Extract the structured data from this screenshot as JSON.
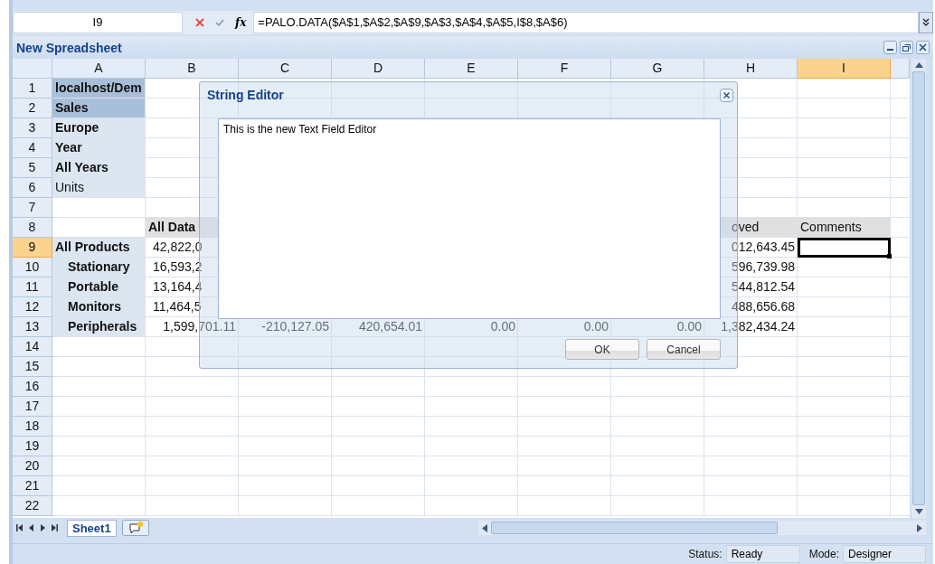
{
  "formula_bar": {
    "cell_name": "I9",
    "function_label": "fx",
    "formula": "=PALO.DATA($A$1,$A$2,$A$9,$A$3,$A$4,$A$5,I$8,$A$6)"
  },
  "window": {
    "title": "New Spreadsheet"
  },
  "columns": [
    {
      "label": "A",
      "selected": false
    },
    {
      "label": "B",
      "selected": false
    },
    {
      "label": "C",
      "selected": false
    },
    {
      "label": "D",
      "selected": false
    },
    {
      "label": "E",
      "selected": false
    },
    {
      "label": "F",
      "selected": false
    },
    {
      "label": "G",
      "selected": false
    },
    {
      "label": "H",
      "selected": false
    },
    {
      "label": "I",
      "selected": true
    }
  ],
  "rows": [
    {
      "label": "1",
      "selected": false,
      "cells": {
        "A": {
          "text": "localhost/Dem",
          "kind": "key-dark"
        }
      }
    },
    {
      "label": "2",
      "selected": false,
      "cells": {
        "A": {
          "text": "Sales",
          "kind": "key-dark"
        }
      }
    },
    {
      "label": "3",
      "selected": false,
      "cells": {
        "A": {
          "text": "Europe",
          "kind": "key"
        }
      }
    },
    {
      "label": "4",
      "selected": false,
      "cells": {
        "A": {
          "text": "Year",
          "kind": "key"
        }
      }
    },
    {
      "label": "5",
      "selected": false,
      "cells": {
        "A": {
          "text": "All Years",
          "kind": "key"
        }
      }
    },
    {
      "label": "6",
      "selected": false,
      "cells": {
        "A": {
          "text": "Units",
          "kind": "key-plain"
        }
      }
    },
    {
      "label": "7",
      "selected": false
    },
    {
      "label": "8",
      "selected": false,
      "cells": {
        "B": {
          "text": "All Data",
          "kind": "heading-bold"
        },
        "H": {
          "text": "oved",
          "kind": "heading-cut"
        },
        "I": {
          "text": "Comments",
          "kind": "heading"
        }
      }
    },
    {
      "label": "9",
      "selected": true,
      "cells": {
        "A": {
          "text": "All Products",
          "kind": "key"
        },
        "B": {
          "text": "42,822,0",
          "kind": "number-cut"
        },
        "H": {
          "text": "012,643.45",
          "kind": "number"
        }
      }
    },
    {
      "label": "10",
      "selected": false,
      "cells": {
        "A": {
          "text": "Stationary",
          "kind": "key-sub"
        },
        "B": {
          "text": "16,593,2",
          "kind": "number-cut"
        },
        "H": {
          "text": "596,739.98",
          "kind": "number"
        }
      }
    },
    {
      "label": "11",
      "selected": false,
      "cells": {
        "A": {
          "text": "Portable",
          "kind": "key-sub"
        },
        "B": {
          "text": "13,164,4",
          "kind": "number-cut"
        },
        "H": {
          "text": "544,812.54",
          "kind": "number"
        }
      }
    },
    {
      "label": "12",
      "selected": false,
      "cells": {
        "A": {
          "text": "Monitors",
          "kind": "key-sub"
        },
        "B": {
          "text": "11,464,5",
          "kind": "number-cut"
        },
        "H": {
          "text": "488,656.68",
          "kind": "number"
        }
      }
    },
    {
      "label": "13",
      "selected": false,
      "cells": {
        "A": {
          "text": "Peripherals",
          "kind": "key-sub"
        },
        "B": {
          "text": "1,599,701.11",
          "kind": "number"
        },
        "C": {
          "text": "-210,127.05",
          "kind": "number"
        },
        "D": {
          "text": "420,654.01",
          "kind": "number"
        },
        "E": {
          "text": "0.00",
          "kind": "number"
        },
        "F": {
          "text": "0.00",
          "kind": "number"
        },
        "G": {
          "text": "0.00",
          "kind": "number"
        },
        "H": {
          "text": "1,382,434.24",
          "kind": "number"
        }
      }
    },
    {
      "label": "14",
      "selected": false
    },
    {
      "label": "15",
      "selected": false
    },
    {
      "label": "16",
      "selected": false
    },
    {
      "label": "17",
      "selected": false
    },
    {
      "label": "18",
      "selected": false
    },
    {
      "label": "19",
      "selected": false
    },
    {
      "label": "20",
      "selected": false
    },
    {
      "label": "21",
      "selected": false
    },
    {
      "label": "22",
      "selected": false
    }
  ],
  "dialog": {
    "title": "String Editor",
    "value": "This is the new Text Field Editor",
    "buttons": [
      "OK",
      "Cancel"
    ]
  },
  "sheet_tabs": [
    {
      "label": "Sheet1",
      "selected": true
    }
  ],
  "status_bar": {
    "status_label": "Status:",
    "status": "Ready",
    "mode_label": "Mode:",
    "mode": "Designer"
  }
}
